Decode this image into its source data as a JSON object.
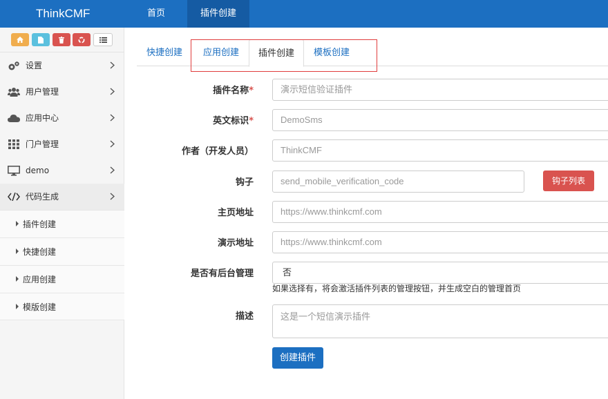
{
  "header": {
    "brand": "ThinkCMF",
    "nav": [
      "首页",
      "插件创建"
    ]
  },
  "sidebar": {
    "shortcuts": [
      {
        "icon": "home-icon",
        "color": "#f0ad4e"
      },
      {
        "icon": "file-icon",
        "color": "#5bc0de"
      },
      {
        "icon": "trash-icon",
        "color": "#d9534f"
      },
      {
        "icon": "recycle-icon",
        "color": "#d9534f"
      },
      {
        "icon": "list-icon",
        "color": "#ffffff"
      }
    ],
    "items": [
      {
        "label": "设置",
        "icon": "gears-icon"
      },
      {
        "label": "用户管理",
        "icon": "users-icon"
      },
      {
        "label": "应用中心",
        "icon": "cloud-icon"
      },
      {
        "label": "门户管理",
        "icon": "grid-icon"
      },
      {
        "label": "demo",
        "icon": "desktop-icon"
      },
      {
        "label": "代码生成",
        "icon": "code-icon"
      }
    ],
    "subitems": [
      "插件创建",
      "快捷创建",
      "应用创建",
      "模版创建"
    ]
  },
  "tabs": [
    "快捷创建",
    "应用创建",
    "插件创建",
    "模板创建"
  ],
  "form": {
    "name": {
      "label": "插件名称",
      "required": "*",
      "placeholder": "演示短信验证插件"
    },
    "id": {
      "label": "英文标识",
      "required": "*",
      "placeholder": "DemoSms"
    },
    "author": {
      "label": "作者（开发人员）",
      "placeholder": "ThinkCMF"
    },
    "hook": {
      "label": "钩子",
      "placeholder": "send_mobile_verification_code",
      "button": "钩子列表"
    },
    "homepage": {
      "label": "主页地址",
      "placeholder": "https://www.thinkcmf.com"
    },
    "demo": {
      "label": "演示地址",
      "placeholder": "https://www.thinkcmf.com"
    },
    "admin": {
      "label": "是否有后台管理",
      "value": "否",
      "help": "如果选择有，将会激活插件列表的管理按钮，并生成空白的管理首页"
    },
    "desc": {
      "label": "描述",
      "placeholder": "这是一个短信演示插件"
    },
    "submit": "创建插件"
  },
  "colors": {
    "primary": "#1c6fc1",
    "danger": "#d9534f",
    "warning": "#f0ad4e",
    "info": "#5bc0de"
  }
}
